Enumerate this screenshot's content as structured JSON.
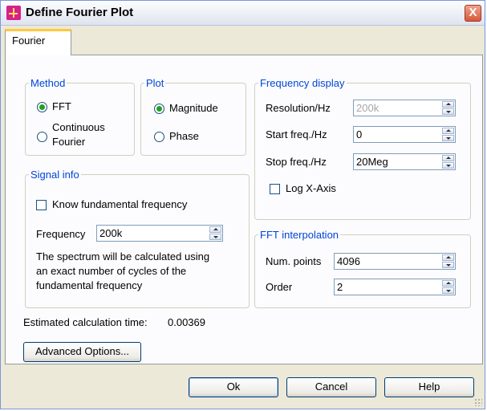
{
  "window": {
    "title": "Define Fourier Plot",
    "close_label": "X"
  },
  "tabs": [
    {
      "label": "Fourier"
    }
  ],
  "method": {
    "legend": "Method",
    "options": [
      {
        "label": "FFT",
        "selected": true
      },
      {
        "label": "Continuous",
        "label_line2": "Fourier",
        "selected": false
      }
    ]
  },
  "plot": {
    "legend": "Plot",
    "options": [
      {
        "label": "Magnitude",
        "selected": true
      },
      {
        "label": "Phase",
        "selected": false
      }
    ]
  },
  "frequency_display": {
    "legend": "Frequency display",
    "resolution": {
      "label": "Resolution/Hz",
      "value": "200k",
      "disabled": true
    },
    "start": {
      "label": "Start freq./Hz",
      "value": "0"
    },
    "stop": {
      "label": "Stop freq./Hz",
      "value": "20Meg"
    },
    "log_x_axis": {
      "label": "Log X-Axis",
      "checked": false
    }
  },
  "signal_info": {
    "legend": "Signal info",
    "know_fundamental": {
      "label": "Know fundamental frequency",
      "checked": false
    },
    "frequency": {
      "label": "Frequency",
      "value": "200k"
    },
    "note_lines": [
      "The spectrum will be calculated using",
      "an exact number of cycles of the",
      "fundamental frequency"
    ]
  },
  "fft_interpolation": {
    "legend": "FFT interpolation",
    "num_points": {
      "label": "Num. points",
      "value": "4096"
    },
    "order": {
      "label": "Order",
      "value": "2"
    }
  },
  "estimate": {
    "label": "Estimated calculation time:",
    "value": "0.00369"
  },
  "buttons": {
    "advanced": "Advanced Options...",
    "ok": "Ok",
    "cancel": "Cancel",
    "help": "Help"
  }
}
